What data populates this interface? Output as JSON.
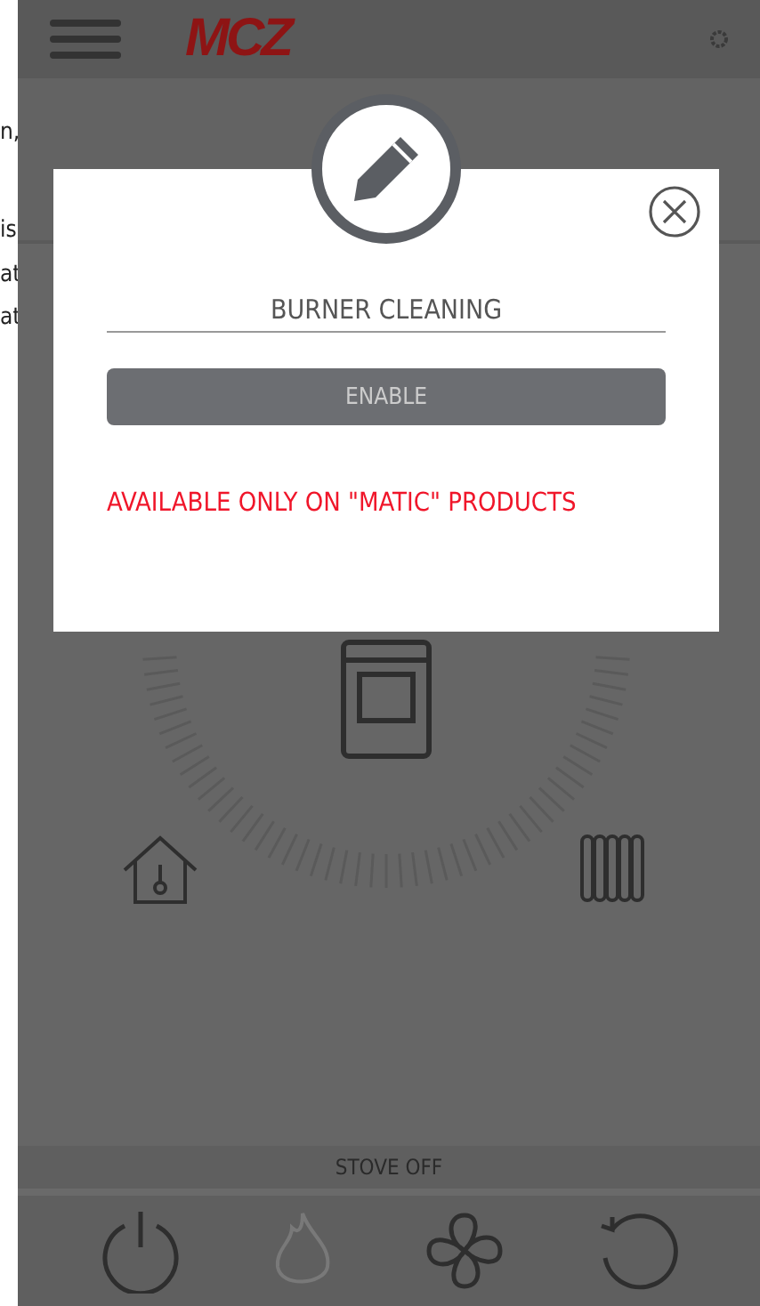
{
  "background_page": {
    "text_fragments": [
      "n,",
      "is",
      "at",
      "at"
    ]
  },
  "header": {
    "logo": "MCZ"
  },
  "dialog": {
    "title": "BURNER CLEANING",
    "button": {
      "label": "ENABLE"
    },
    "notice": "AVAILABLE ONLY ON \"MATIC\" PRODUCTS"
  },
  "status": "STOVE OFF",
  "bottom_bar": [
    {
      "kind": "power",
      "disabled": false
    },
    {
      "kind": "flame",
      "disabled": true
    },
    {
      "kind": "fan",
      "disabled": false
    },
    {
      "kind": "reset",
      "disabled": false
    }
  ]
}
